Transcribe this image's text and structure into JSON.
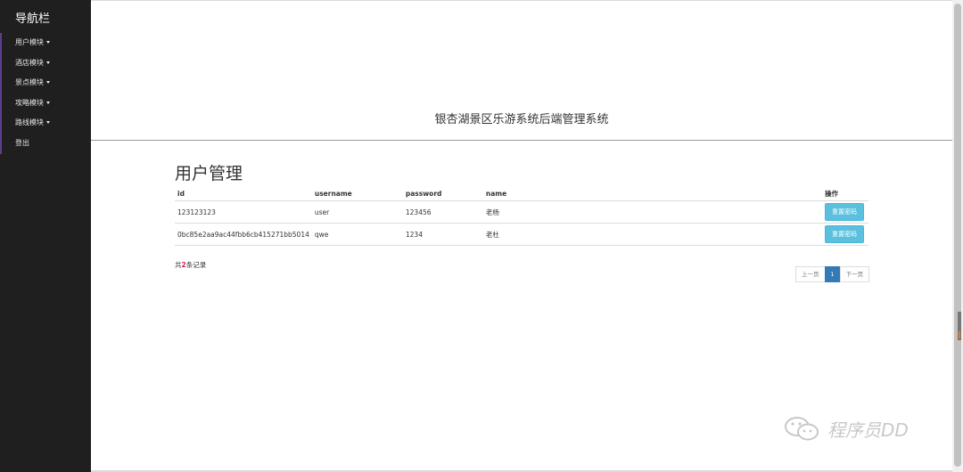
{
  "sidebar": {
    "brand": "导航栏",
    "items": [
      {
        "label": "用户模块",
        "has_caret": true
      },
      {
        "label": "酒店模块",
        "has_caret": true
      },
      {
        "label": "景点模块",
        "has_caret": true
      },
      {
        "label": "攻略模块",
        "has_caret": true
      },
      {
        "label": "路线模块",
        "has_caret": true
      },
      {
        "label": "登出",
        "has_caret": false
      }
    ]
  },
  "header": {
    "title": "银杏湖景区乐游系统后端管理系统"
  },
  "main": {
    "page_title": "用户管理",
    "table": {
      "columns": [
        "id",
        "username",
        "password",
        "name",
        "操作"
      ],
      "rows": [
        {
          "id": "123123123",
          "username": "user",
          "password": "123456",
          "name": "老杨",
          "action": "重置密码"
        },
        {
          "id": "0bc85e2aa9ac44fbb6cb415271bb5014",
          "username": "qwe",
          "password": "1234",
          "name": "老杜",
          "action": "重置密码"
        }
      ]
    },
    "total": {
      "prefix": "共",
      "count": "2",
      "suffix": "条记录"
    },
    "pagination": {
      "prev": "上一页",
      "current": "1",
      "next": "下一页"
    }
  },
  "watermark": {
    "text": "程序员DD",
    "icon": "wechat-icon"
  },
  "colors": {
    "sidebar_bg": "#1f1f1f",
    "accent": "#5b3f8a",
    "button": "#5bc0de",
    "pager_active": "#337ab7"
  }
}
